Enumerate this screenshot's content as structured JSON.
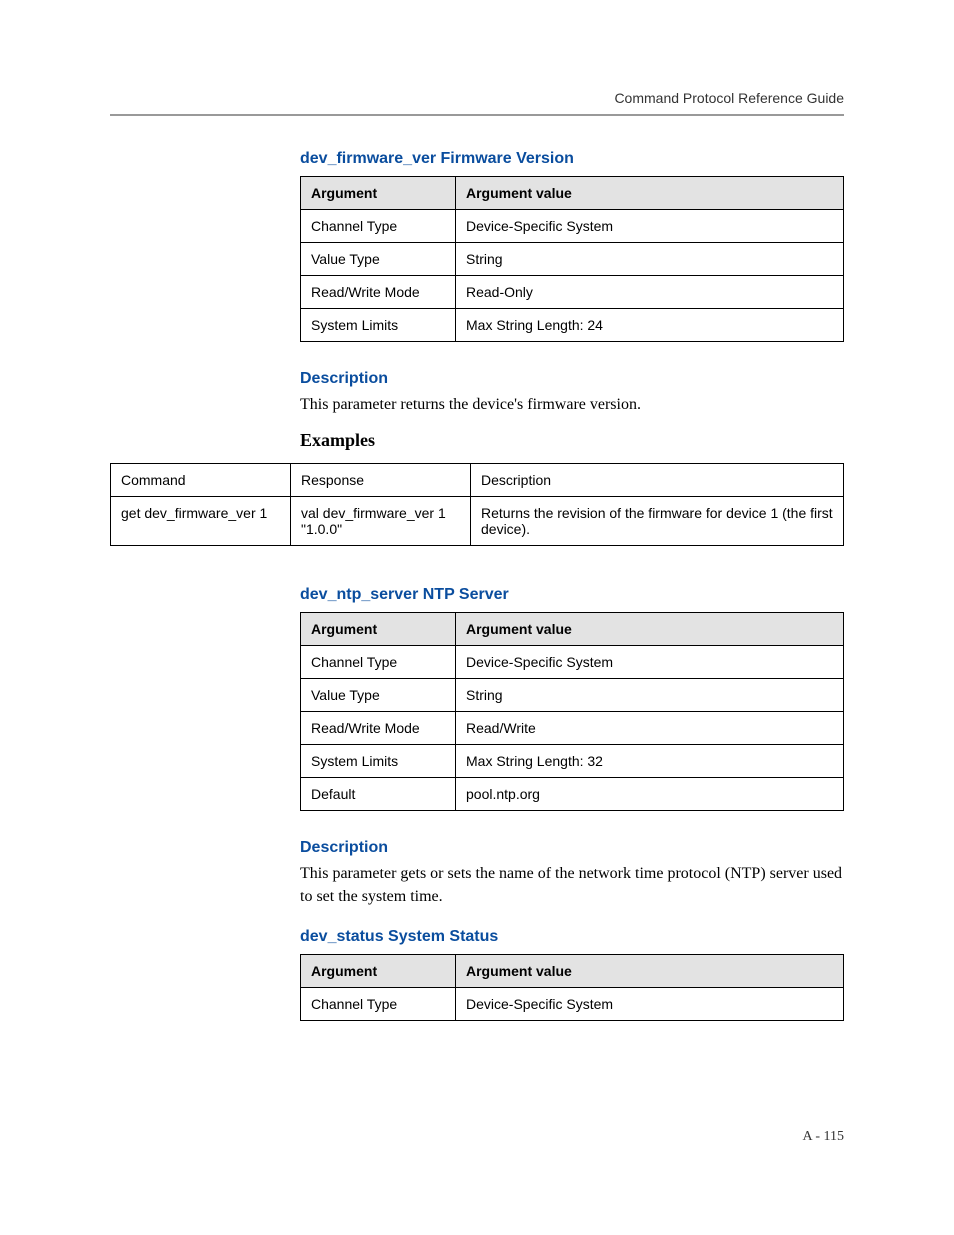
{
  "header": {
    "title": "Command Protocol Reference Guide"
  },
  "page_number": "A - 115",
  "sections": {
    "firmware": {
      "title": "dev_firmware_ver Firmware Version",
      "arg_header_col1": "Argument",
      "arg_header_col2": "Argument value",
      "rows": [
        {
          "arg": "Channel Type",
          "val": "Device-Specific System"
        },
        {
          "arg": "Value Type",
          "val": "String"
        },
        {
          "arg": "Read/Write Mode",
          "val": "Read-Only"
        },
        {
          "arg": "System Limits",
          "val": "Max String Length: 24"
        }
      ],
      "description_heading": "Description",
      "description_text": "This parameter returns the device's firmware version.",
      "examples_heading": "Examples",
      "examples_header": {
        "c1": "Command",
        "c2": "Response",
        "c3": "Description"
      },
      "examples_rows": [
        {
          "command": "get dev_firmware_ver 1",
          "response": "val dev_firmware_ver 1 \"1.0.0\"",
          "desc": "Returns the revision of the firmware for device 1 (the first device)."
        }
      ]
    },
    "ntp": {
      "title": "dev_ntp_server NTP Server",
      "arg_header_col1": "Argument",
      "arg_header_col2": "Argument value",
      "rows": [
        {
          "arg": "Channel Type",
          "val": "Device-Specific System"
        },
        {
          "arg": "Value Type",
          "val": "String"
        },
        {
          "arg": "Read/Write Mode",
          "val": "Read/Write"
        },
        {
          "arg": "System Limits",
          "val": "Max String Length: 32"
        },
        {
          "arg": "Default",
          "val": "pool.ntp.org"
        }
      ],
      "description_heading": "Description",
      "description_text": "This parameter gets or sets the name of the network time protocol (NTP) server used to set the system time."
    },
    "status": {
      "title": "dev_status System Status",
      "arg_header_col1": "Argument",
      "arg_header_col2": "Argument value",
      "rows": [
        {
          "arg": "Channel Type",
          "val": "Device-Specific System"
        }
      ]
    }
  }
}
